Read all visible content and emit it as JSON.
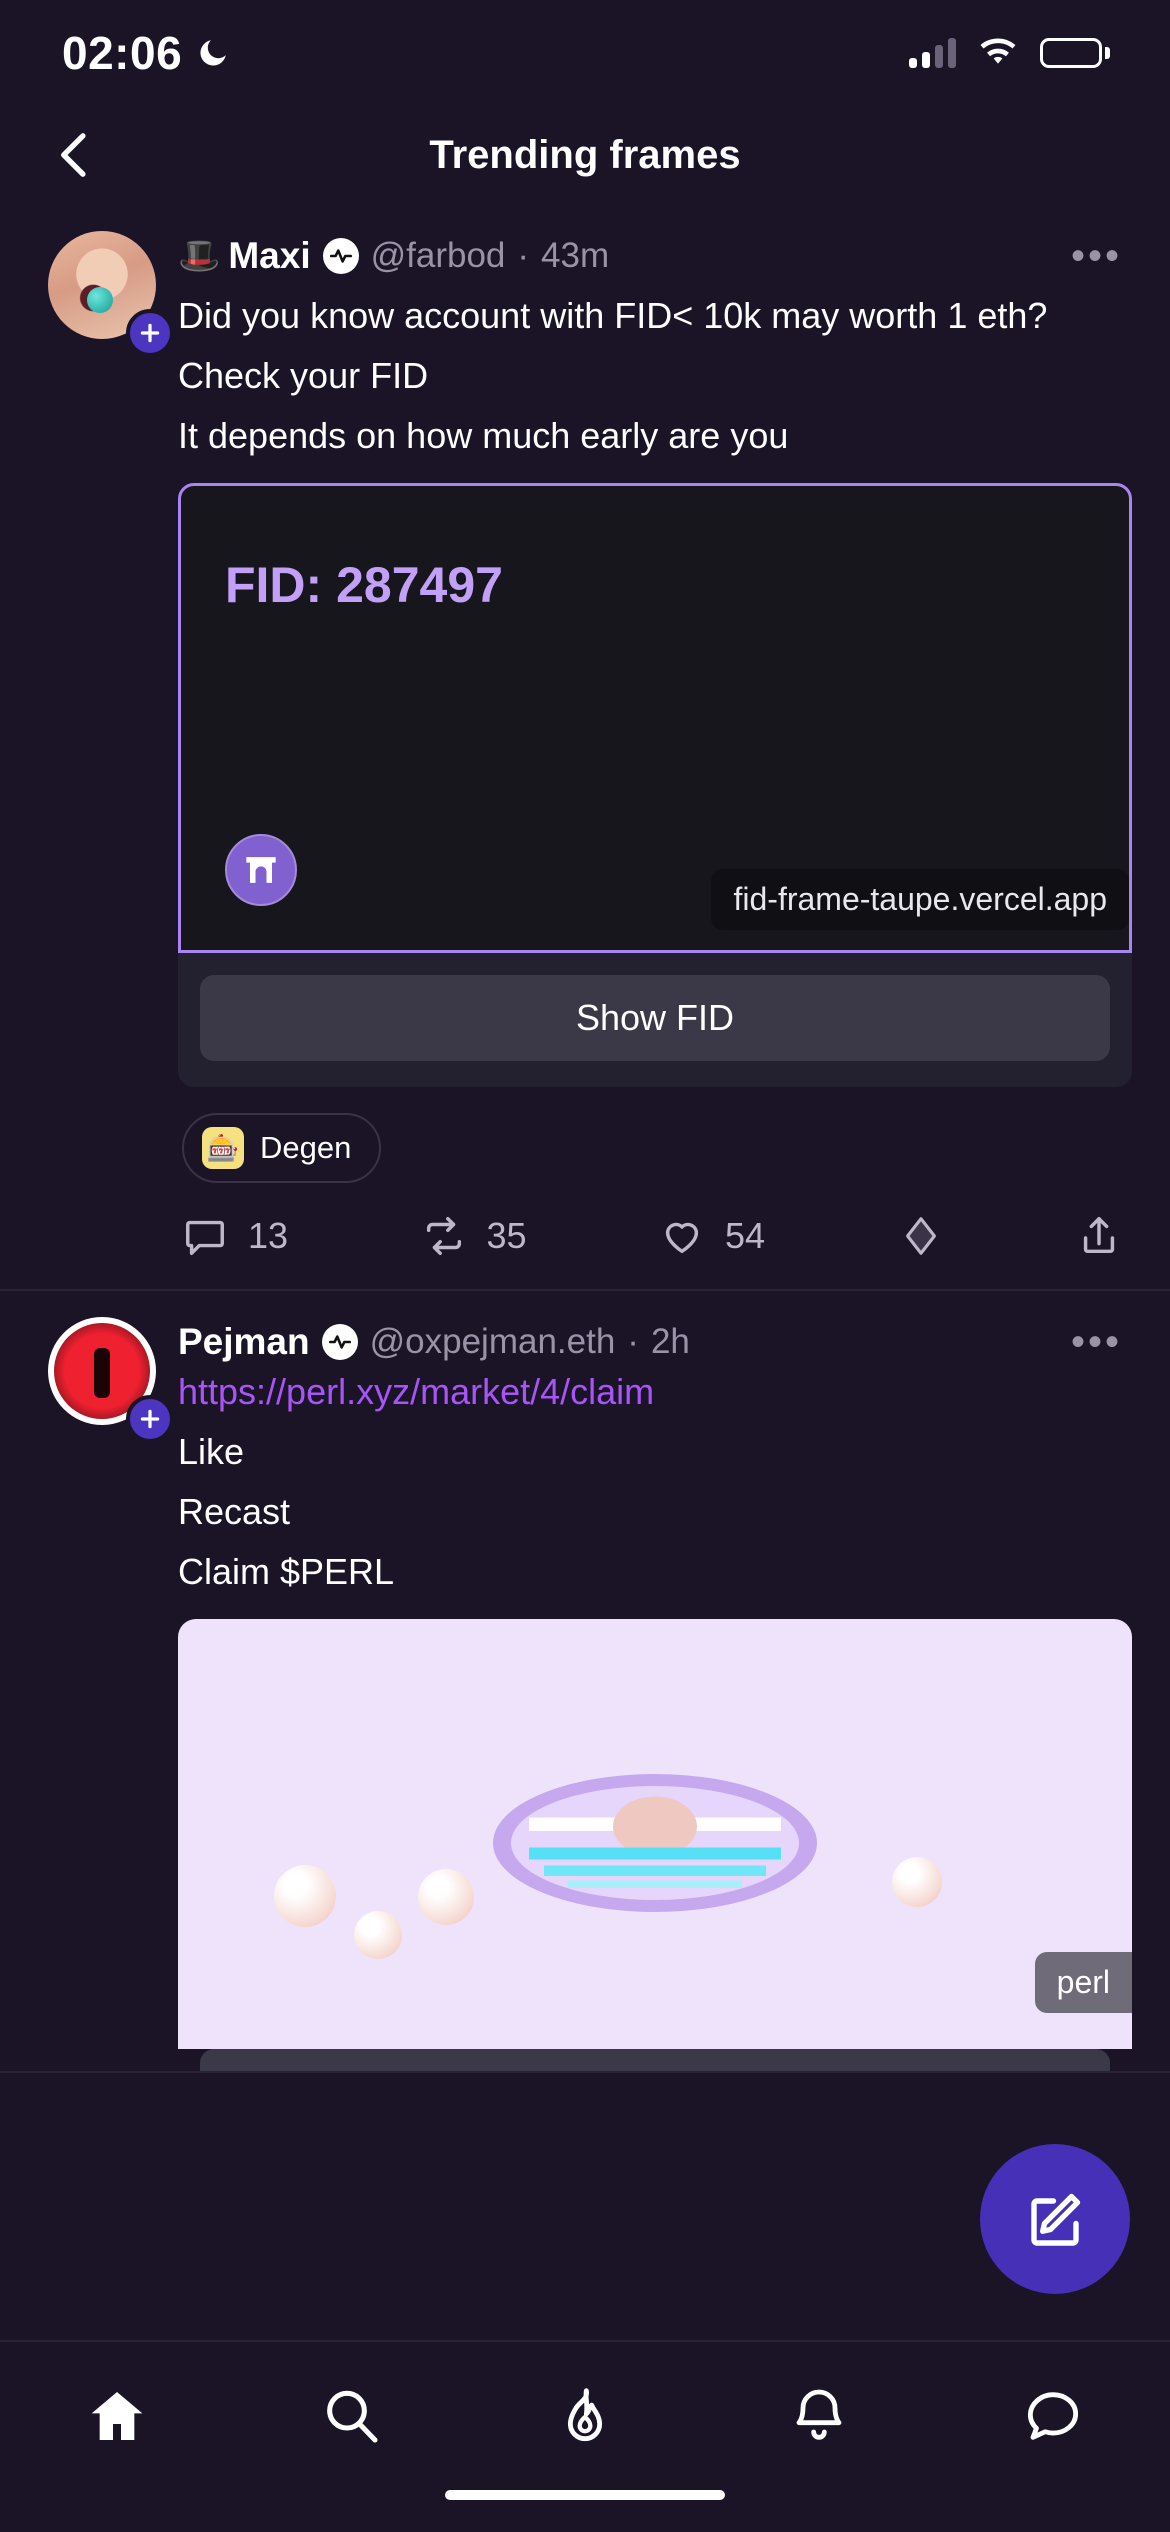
{
  "status_bar": {
    "time": "02:06",
    "dnd_icon": "moon-icon",
    "signal_icon": "cellular-signal-icon",
    "wifi_icon": "wifi-icon",
    "battery_icon": "battery-full-icon"
  },
  "header": {
    "back_icon": "chevron-left-icon",
    "title": "Trending frames"
  },
  "posts": [
    {
      "avatar_name": "avatar-maxi",
      "follow_icon": "plus-icon",
      "name_emoji": "🎩",
      "display_name": "Maxi",
      "verified_icon": "power-badge-icon",
      "handle": "@farbod",
      "separator": "·",
      "timestamp": "43m",
      "more_icon": "more-options-icon",
      "text_lines": [
        "Did you know account with FID< 10k may worth 1 eth?",
        "Check your FID",
        "It depends on how much early are  you"
      ],
      "frame": {
        "fid_label": "FID: 287497",
        "logo_icon": "farcaster-arch-icon",
        "url": "fid-frame-taupe.vercel.app",
        "button_label": "Show FID",
        "border_color": "#a985f0"
      },
      "channel": {
        "icon": "degen-hat-icon",
        "emoji": "🎰",
        "label": "Degen"
      },
      "actions": {
        "comment_icon": "comment-icon",
        "comment_count": "13",
        "recast_icon": "recast-icon",
        "recast_count": "35",
        "like_icon": "heart-icon",
        "like_count": "54",
        "tip_icon": "diamond-icon",
        "share_icon": "share-icon"
      }
    },
    {
      "avatar_name": "avatar-pejman",
      "follow_icon": "plus-icon",
      "display_name": "Pejman",
      "verified_icon": "power-badge-icon",
      "handle": "@oxpejman.eth",
      "separator": "·",
      "timestamp": "2h",
      "more_icon": "more-options-icon",
      "link": "https://perl.xyz/market/4/claim",
      "text_lines": [
        " Like",
        "Recast",
        "Claim $PERL"
      ],
      "image": {
        "alt_name": "pixel-pearl-artwork",
        "url_badge": "perl"
      }
    }
  ],
  "fab": {
    "icon": "compose-icon"
  },
  "tabbar": {
    "items": [
      {
        "name": "tab-home",
        "icon": "home-icon",
        "active": true
      },
      {
        "name": "tab-search",
        "icon": "search-icon",
        "active": false
      },
      {
        "name": "tab-trending",
        "icon": "flame-icon",
        "active": false
      },
      {
        "name": "tab-notifications",
        "icon": "bell-icon",
        "active": false
      },
      {
        "name": "tab-messages",
        "icon": "chat-icon",
        "active": false
      }
    ]
  },
  "colors": {
    "background": "#1b1427",
    "accent_purple": "#4630b8",
    "frame_purple": "#a985f0",
    "link_purple": "#a855f7",
    "muted_text": "#9a93a8"
  }
}
